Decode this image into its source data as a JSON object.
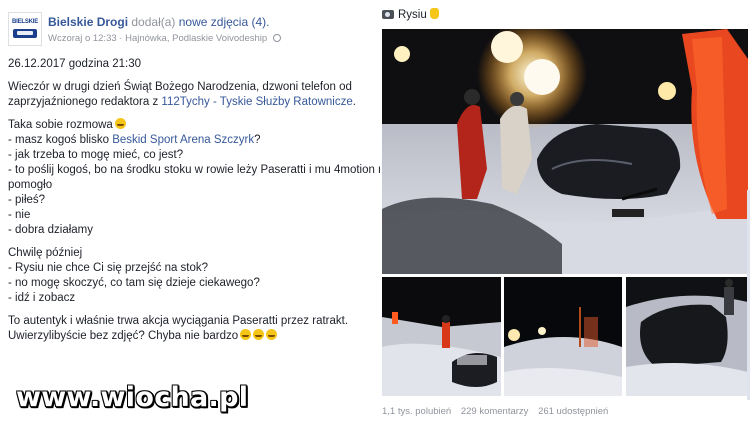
{
  "header": {
    "page_name": "Bielskie Drogi",
    "action_text": "dodał(a)",
    "action_link": "nowe zdjęcia (4).",
    "timestamp": "Wczoraj o 12:33",
    "location": "Hajnówka, Podlaskie Voivodeship"
  },
  "post": {
    "date_line": "26.12.2017 godzina 21:30",
    "intro_1": "Wieczór w drugi dzień Świąt Bożego Narodzenia, dzwoni telefon od",
    "intro_2_prefix": "zaprzyjaźnionego redaktora z ",
    "intro_2_link": "112Tychy - Tyskie Służby Ratownicze",
    "intro_2_suffix": ".",
    "talk_title": "Taka sobie rozmowa",
    "line_a_prefix": "- masz kogoś blisko ",
    "line_a_link": "Beskid Sport Arena Szczyrk",
    "line_a_suffix": "?",
    "line_b": "- jak trzeba to mogę mieć, co jest?",
    "line_c": "- to poślij kogoś, bo na środku stoku w rowie leży Paseratti i mu 4motion nie",
    "line_d": "pomogło",
    "line_e": "- piłeś?",
    "line_f": "- nie",
    "line_g": "- dobra działamy",
    "later_title": "Chwilę później",
    "line_h": "- Rysiu nie chce Ci się przejść na stok?",
    "line_i": "- no mogę skoczyć, co tam się dzieje ciekawego?",
    "line_j": "- idź i zobacz",
    "outro_1": "To autentyk i właśnie trwa akcja wyciągania Paseratti przez ratrakt.",
    "outro_2": "Uwierzylibyście bez zdjęć? Chyba nie bardzo"
  },
  "photos": {
    "caption": "Rysiu",
    "stats": {
      "likes": "1,1 tys. polubień",
      "comments": "229 komentarzy",
      "shares": "261 udostępnień"
    }
  },
  "watermark": "www.wiocha.pl",
  "icons": [
    "avatar-logo",
    "globe-icon",
    "smile-emoji-icon",
    "laugh-emoji-icon",
    "camera-icon",
    "pointing-hand-icon"
  ],
  "colors": {
    "link": "#365899",
    "meta": "#90949c",
    "text": "#1d2129"
  }
}
